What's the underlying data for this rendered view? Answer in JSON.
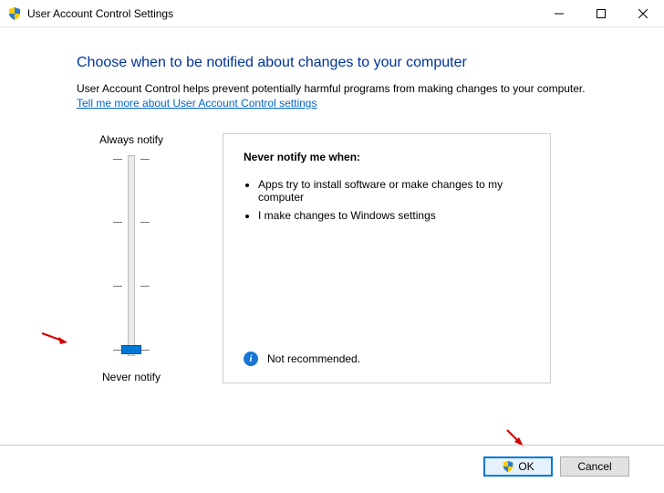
{
  "window": {
    "title": "User Account Control Settings"
  },
  "heading": "Choose when to be notified about changes to your computer",
  "description": "User Account Control helps prevent potentially harmful programs from making changes to your computer.",
  "link": "Tell me more about User Account Control settings",
  "slider": {
    "top_label": "Always notify",
    "bottom_label": "Never notify",
    "levels": 4,
    "value": 0
  },
  "info": {
    "title": "Never notify me when:",
    "bullets": [
      "Apps try to install software or make changes to my computer",
      "I make changes to Windows settings"
    ],
    "note": "Not recommended."
  },
  "buttons": {
    "ok": "OK",
    "cancel": "Cancel"
  }
}
